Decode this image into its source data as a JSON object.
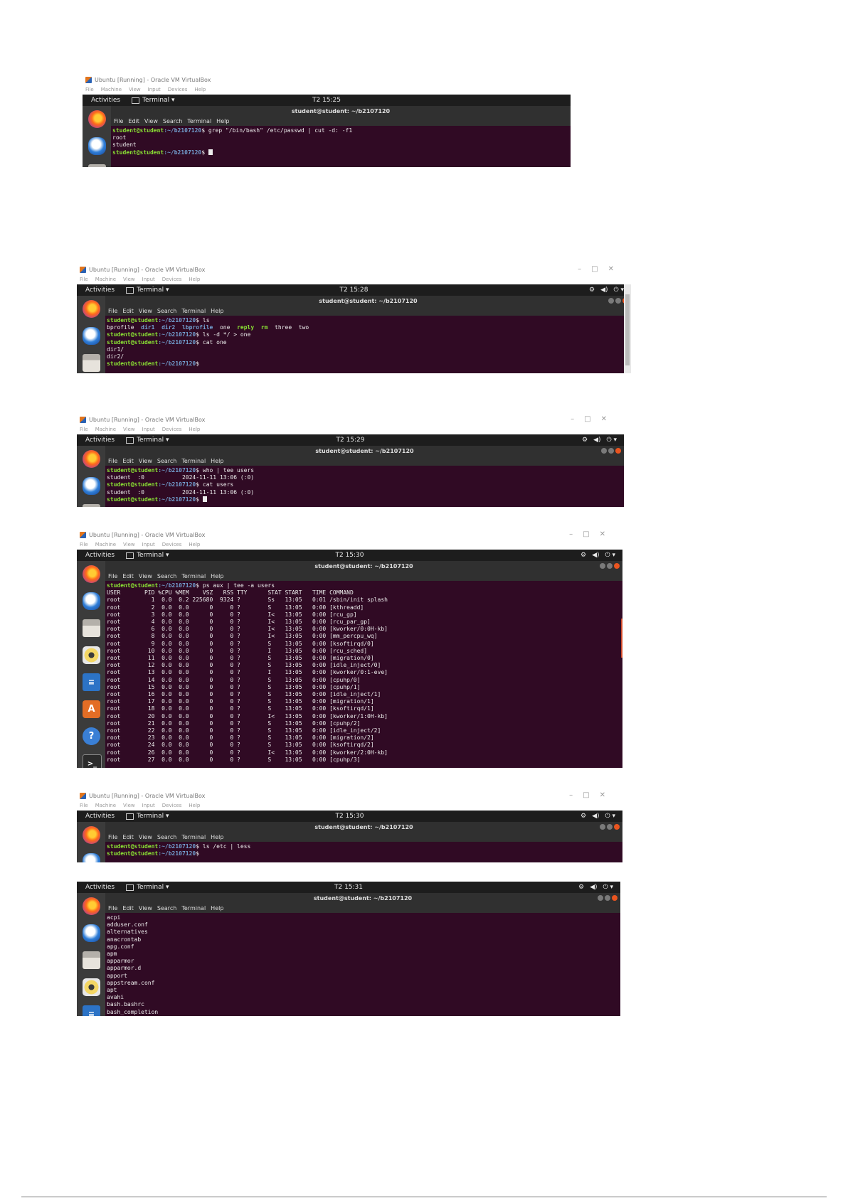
{
  "virtualbox": {
    "window_title": "Ubuntu [Running] - Oracle VM VirtualBox",
    "menu": [
      "File",
      "Machine",
      "View",
      "Input",
      "Devices",
      "Help"
    ],
    "controls": [
      "–",
      "□",
      "✕"
    ]
  },
  "ubuntu": {
    "activities_label": "Activities",
    "terminal_label": "Terminal ▾",
    "window_title": "student@student: ~/b2107120",
    "terminal_menu": [
      "File",
      "Edit",
      "View",
      "Search",
      "Terminal",
      "Help"
    ],
    "system_tray": [
      "⚙",
      "◀)",
      "⏻ ▾"
    ],
    "prompt_user": "student@student",
    "prompt_path": ":~/b2107120",
    "prompt_sign": "$"
  },
  "screenshots": [
    {
      "id": "grep-cut",
      "clock": "T2 15:25",
      "lines": [
        {
          "type": "prompt",
          "cmd": " grep \"/bin/bash\" /etc/passwd | cut -d: -f1"
        },
        {
          "type": "out",
          "text": "root"
        },
        {
          "type": "out",
          "text": "student"
        },
        {
          "type": "prompt",
          "cmd": " ",
          "cursor": true
        }
      ]
    },
    {
      "id": "ls-redirect",
      "clock": "T2 15:28",
      "lines": [
        {
          "type": "prompt",
          "cmd": " ls"
        },
        {
          "type": "tokens",
          "tokens": [
            {
              "t": "bprofile  "
            },
            {
              "t": "dir1",
              "c": "dir"
            },
            {
              "t": "  "
            },
            {
              "t": "dir2",
              "c": "dir"
            },
            {
              "t": "  "
            },
            {
              "t": "lbprofile",
              "c": "dir"
            },
            {
              "t": "  one  "
            },
            {
              "t": "reply",
              "c": "ex"
            },
            {
              "t": "  "
            },
            {
              "t": "rm",
              "c": "ex"
            },
            {
              "t": "  three  two"
            }
          ]
        },
        {
          "type": "prompt",
          "cmd": " ls -d */ > one"
        },
        {
          "type": "prompt",
          "cmd": " cat one"
        },
        {
          "type": "out",
          "text": "dir1/"
        },
        {
          "type": "out",
          "text": "dir2/"
        },
        {
          "type": "prompt",
          "cmd": ""
        }
      ]
    },
    {
      "id": "who-tee",
      "clock": "T2 15:29",
      "lines": [
        {
          "type": "prompt",
          "cmd": " who | tee users"
        },
        {
          "type": "out",
          "text": "student  :0           2024-11-11 13:06 (:0)"
        },
        {
          "type": "prompt",
          "cmd": " cat users"
        },
        {
          "type": "out",
          "text": "student  :0           2024-11-11 13:06 (:0)"
        },
        {
          "type": "prompt",
          "cmd": " ",
          "cursor": true
        }
      ]
    },
    {
      "id": "ps-aux",
      "clock": "T2 15:30",
      "lines": [
        {
          "type": "prompt",
          "cmd": " ps aux | tee -a users"
        },
        {
          "type": "out",
          "text": "USER       PID %CPU %MEM    VSZ   RSS TTY      STAT START   TIME COMMAND"
        },
        {
          "type": "out",
          "text": "root         1  0.0  0.2 225680  9324 ?        Ss   13:05   0:01 /sbin/init splash"
        },
        {
          "type": "out",
          "text": "root         2  0.0  0.0      0     0 ?        S    13:05   0:00 [kthreadd]"
        },
        {
          "type": "out",
          "text": "root         3  0.0  0.0      0     0 ?        I<   13:05   0:00 [rcu_gp]"
        },
        {
          "type": "out",
          "text": "root         4  0.0  0.0      0     0 ?        I<   13:05   0:00 [rcu_par_gp]"
        },
        {
          "type": "out",
          "text": "root         6  0.0  0.0      0     0 ?        I<   13:05   0:00 [kworker/0:0H-kb]"
        },
        {
          "type": "out",
          "text": "root         8  0.0  0.0      0     0 ?        I<   13:05   0:00 [mm_percpu_wq]"
        },
        {
          "type": "out",
          "text": "root         9  0.0  0.0      0     0 ?        S    13:05   0:00 [ksoftirqd/0]"
        },
        {
          "type": "out",
          "text": "root        10  0.0  0.0      0     0 ?        I    13:05   0:00 [rcu_sched]"
        },
        {
          "type": "out",
          "text": "root        11  0.0  0.0      0     0 ?        S    13:05   0:00 [migration/0]"
        },
        {
          "type": "out",
          "text": "root        12  0.0  0.0      0     0 ?        S    13:05   0:00 [idle_inject/0]"
        },
        {
          "type": "out",
          "text": "root        13  0.0  0.0      0     0 ?        I    13:05   0:00 [kworker/0:1-eve]"
        },
        {
          "type": "out",
          "text": "root        14  0.0  0.0      0     0 ?        S    13:05   0:00 [cpuhp/0]"
        },
        {
          "type": "out",
          "text": "root        15  0.0  0.0      0     0 ?        S    13:05   0:00 [cpuhp/1]"
        },
        {
          "type": "out",
          "text": "root        16  0.0  0.0      0     0 ?        S    13:05   0:00 [idle_inject/1]"
        },
        {
          "type": "out",
          "text": "root        17  0.0  0.0      0     0 ?        S    13:05   0:00 [migration/1]"
        },
        {
          "type": "out",
          "text": "root        18  0.0  0.0      0     0 ?        S    13:05   0:00 [ksoftirqd/1]"
        },
        {
          "type": "out",
          "text": "root        20  0.0  0.0      0     0 ?        I<   13:05   0:00 [kworker/1:0H-kb]"
        },
        {
          "type": "out",
          "text": "root        21  0.0  0.0      0     0 ?        S    13:05   0:00 [cpuhp/2]"
        },
        {
          "type": "out",
          "text": "root        22  0.0  0.0      0     0 ?        S    13:05   0:00 [idle_inject/2]"
        },
        {
          "type": "out",
          "text": "root        23  0.0  0.0      0     0 ?        S    13:05   0:00 [migration/2]"
        },
        {
          "type": "out",
          "text": "root        24  0.0  0.0      0     0 ?        S    13:05   0:00 [ksoftirqd/2]"
        },
        {
          "type": "out",
          "text": "root        26  0.0  0.0      0     0 ?        I<   13:05   0:00 [kworker/2:0H-kb]"
        },
        {
          "type": "out",
          "text": "root        27  0.0  0.0      0     0 ?        S    13:05   0:00 [cpuhp/3]"
        }
      ]
    },
    {
      "id": "ls-less",
      "clock": "T2 15:30",
      "lines": [
        {
          "type": "prompt",
          "cmd": " ls /etc | less"
        },
        {
          "type": "prompt",
          "cmd": ""
        }
      ]
    },
    {
      "id": "less-view",
      "clock": "T2 15:31",
      "lines": [
        {
          "type": "out",
          "text": "acpi"
        },
        {
          "type": "out",
          "text": "adduser.conf"
        },
        {
          "type": "out",
          "text": "alternatives"
        },
        {
          "type": "out",
          "text": "anacrontab"
        },
        {
          "type": "out",
          "text": "apg.conf"
        },
        {
          "type": "out",
          "text": "apm"
        },
        {
          "type": "out",
          "text": "apparmor"
        },
        {
          "type": "out",
          "text": "apparmor.d"
        },
        {
          "type": "out",
          "text": "apport"
        },
        {
          "type": "out",
          "text": "appstream.conf"
        },
        {
          "type": "out",
          "text": "apt"
        },
        {
          "type": "out",
          "text": "avahi"
        },
        {
          "type": "out",
          "text": "bash.bashrc"
        },
        {
          "type": "out",
          "text": "bash_completion"
        }
      ]
    }
  ],
  "dock_icons": [
    {
      "name": "firefox-icon",
      "cls": "firefox",
      "glyph": ""
    },
    {
      "name": "thunderbird-icon",
      "cls": "thunderbird",
      "glyph": ""
    },
    {
      "name": "files-icon",
      "cls": "files",
      "glyph": ""
    },
    {
      "name": "rhythmbox-icon",
      "cls": "music",
      "glyph": ""
    },
    {
      "name": "libreoffice-writer-icon",
      "cls": "writer",
      "glyph": "≡"
    },
    {
      "name": "software-center-icon",
      "cls": "software",
      "glyph": "A"
    },
    {
      "name": "help-icon",
      "cls": "help",
      "glyph": "?"
    },
    {
      "name": "terminal-icon",
      "cls": "terminal",
      "glyph": ">_"
    }
  ]
}
